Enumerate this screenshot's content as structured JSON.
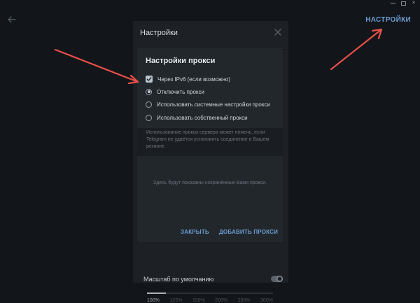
{
  "topbar": {
    "settings_link": "НАСТРОЙКИ"
  },
  "settings_panel": {
    "title": "Настройки",
    "scale_label": "Масштаб по умолчанию",
    "scale_toggle_on": true,
    "scale_ticks": [
      "100%",
      "125%",
      "150%",
      "200%",
      "250%",
      "300%"
    ],
    "scale_selected": "100%"
  },
  "proxy_dialog": {
    "title": "Настройки прокси",
    "ipv6_label": "Через IPv6 (если возможно)",
    "ipv6_checked": true,
    "options": [
      {
        "label": "Отключить прокси",
        "selected": true
      },
      {
        "label": "Использовать системные настройки прокси",
        "selected": false
      },
      {
        "label": "Использовать собственный прокси",
        "selected": false
      }
    ],
    "info_text": "Использование прокси сервера может помочь, если Telegram не удаётся установить соединение в Вашем регионе.",
    "empty_text": "Здесь будут показаны сохранённые Вами прокси.",
    "clear_button": "ЗАКРЫТЬ",
    "add_button": "ДОБАВИТЬ ПРОКСИ"
  },
  "colors": {
    "background": "#121519",
    "panel": "#1d2126",
    "dialog": "#22272c",
    "accent": "#6c9dd1",
    "annotation_arrow": "#e8504a"
  },
  "icons": {
    "back": "arrow-left-icon",
    "close": "close-icon",
    "check": "checkmark-icon"
  }
}
